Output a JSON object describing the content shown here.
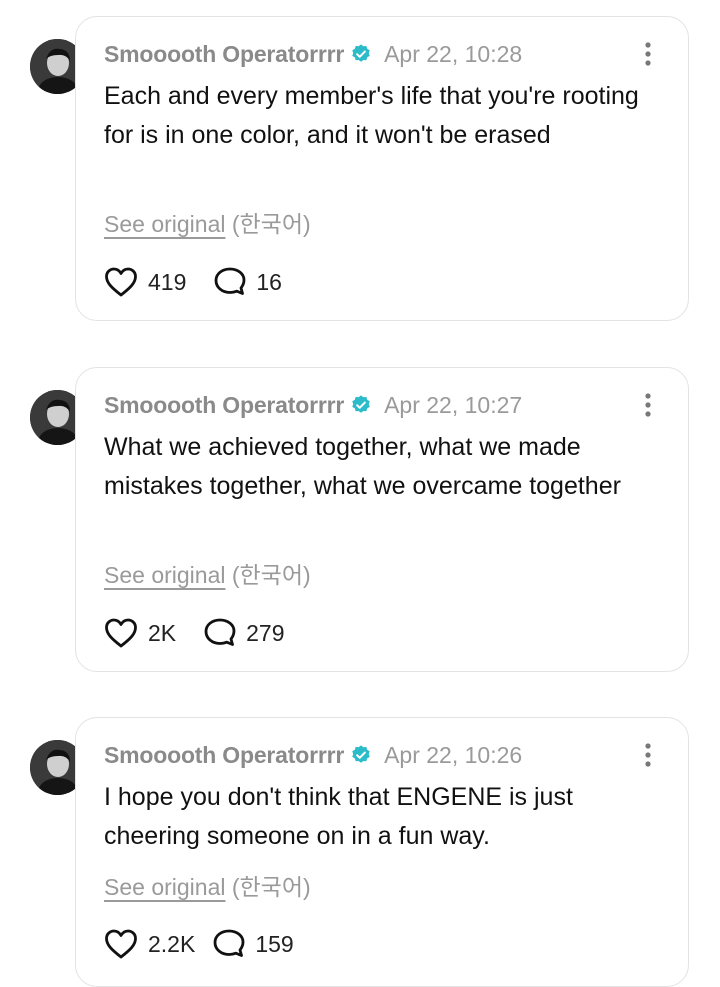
{
  "posts": [
    {
      "username": "Smooooth Operatorrrr",
      "timestamp": "Apr 22, 10:28",
      "text": "Each and every member's life that you're rooting for is in one color, and it won't be erased",
      "see_original_label": "See original",
      "original_language": "(한국어)",
      "likes": "419",
      "comments": "16"
    },
    {
      "username": "Smooooth Operatorrrr",
      "timestamp": "Apr 22, 10:27",
      "text": "What we achieved together, what we made mistakes together, what we overcame together",
      "see_original_label": "See original",
      "original_language": "(한국어)",
      "likes": "2K",
      "comments": "279"
    },
    {
      "username": "Smooooth Operatorrrr",
      "timestamp": "Apr 22, 10:26",
      "text": "I hope you don't think that ENGENE is just cheering someone on in a fun way.",
      "see_original_label": "See original",
      "original_language": "(한국어)",
      "likes": "2.2K",
      "comments": "159"
    }
  ],
  "icons": {
    "verified": "verified-badge-icon",
    "like": "heart-icon",
    "comment": "speech-bubble-icon",
    "more": "more-vertical-icon"
  },
  "colors": {
    "verified": "#2bbbc9",
    "username": "#8a8a8a",
    "text": "#111111",
    "border": "#e3e3e3"
  }
}
